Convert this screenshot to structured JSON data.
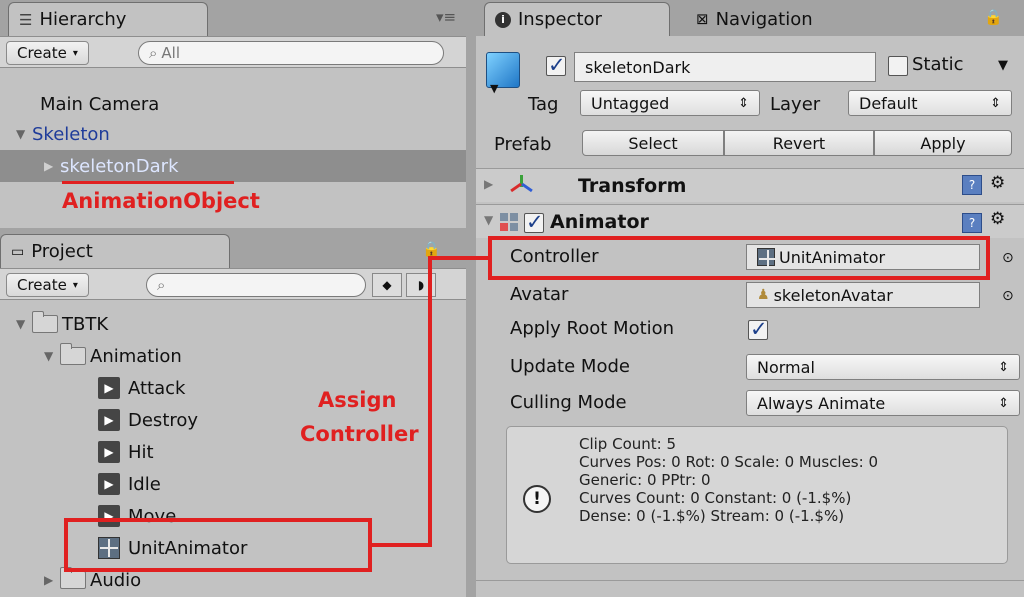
{
  "hierarchy": {
    "tab_label": "Hierarchy",
    "create_label": "Create",
    "search_placeholder": "All",
    "items": [
      {
        "label": "Main Camera"
      },
      {
        "label": "Skeleton"
      },
      {
        "label": "skeletonDark"
      }
    ]
  },
  "project": {
    "tab_label": "Project",
    "create_label": "Create",
    "items": [
      {
        "label": "TBTK"
      },
      {
        "label": "Animation"
      },
      {
        "label": "Attack"
      },
      {
        "label": "Destroy"
      },
      {
        "label": "Hit"
      },
      {
        "label": "Idle"
      },
      {
        "label": "Move"
      },
      {
        "label": "UnitAnimator"
      },
      {
        "label": "Audio"
      }
    ]
  },
  "inspector": {
    "tab_label": "Inspector",
    "nav_tab_label": "Navigation",
    "object_name": "skeletonDark",
    "active_checked": true,
    "static_label": "Static",
    "tag_label": "Tag",
    "tag_value": "Untagged",
    "layer_label": "Layer",
    "layer_value": "Default",
    "prefab_label": "Prefab",
    "prefab_buttons": [
      "Select",
      "Revert",
      "Apply"
    ],
    "transform_label": "Transform",
    "animator_label": "Animator",
    "fields": {
      "controller_label": "Controller",
      "controller_value": "UnitAnimator",
      "avatar_label": "Avatar",
      "avatar_value": "skeletonAvatar",
      "root_motion_label": "Apply Root Motion",
      "root_motion_checked": true,
      "update_mode_label": "Update Mode",
      "update_mode_value": "Normal",
      "culling_mode_label": "Culling Mode",
      "culling_mode_value": "Always Animate"
    },
    "info_lines": [
      "Clip Count: 5",
      "Curves Pos: 0 Rot: 0 Scale: 0 Muscles: 0",
      "Generic: 0 PPtr: 0",
      "Curves Count: 0 Constant: 0 (-1.$%)",
      "Dense: 0 (-1.$%) Stream: 0 (-1.$%)"
    ]
  },
  "annotations": {
    "animation_object": "AnimationObject",
    "assign_line1": "Assign",
    "assign_line2": "Controller",
    "color": "#e02020"
  }
}
